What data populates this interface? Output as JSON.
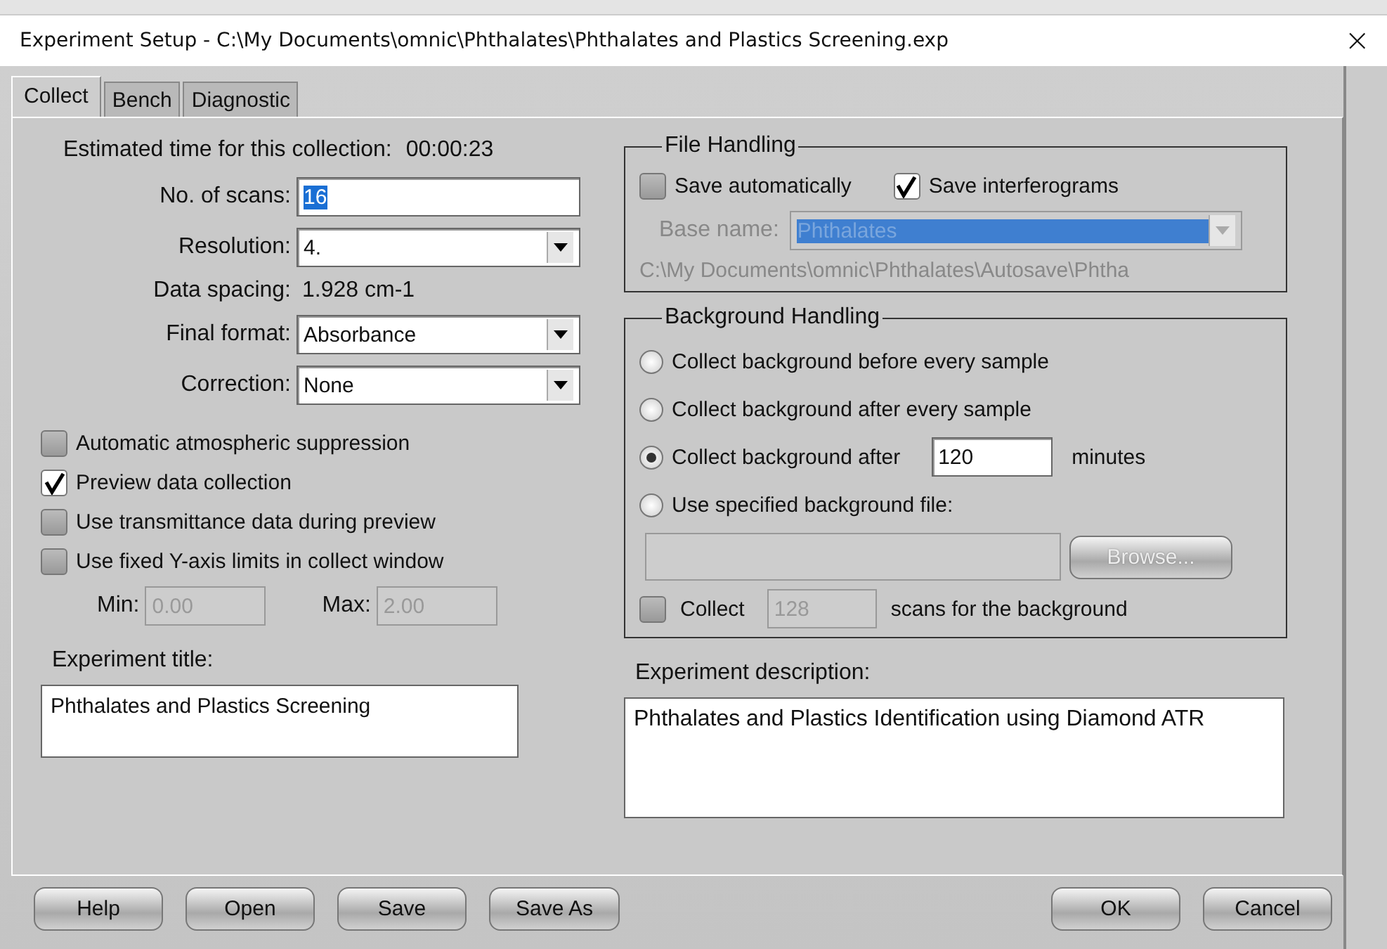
{
  "window": {
    "title": "Experiment Setup - C:\\My Documents\\omnic\\Phthalates\\Phthalates and Plastics Screening.exp",
    "close": "×"
  },
  "tabs": [
    {
      "label": "Collect",
      "selected": true
    },
    {
      "label": "Bench",
      "selected": false
    },
    {
      "label": "Diagnostic",
      "selected": false
    }
  ],
  "collect": {
    "estimated_time": {
      "label": "Estimated time for this collection:",
      "value": "00:00:23"
    },
    "settings": [
      {
        "kind": "input",
        "label": "No. of scans:",
        "value": "16",
        "highlighted": true
      },
      {
        "kind": "dropdown",
        "label": "Resolution:",
        "value": "4."
      },
      {
        "kind": "readout",
        "label": "Data spacing:",
        "value": "1.928 cm-1"
      },
      {
        "kind": "dropdown",
        "label": "Final format:",
        "value": "Absorbance"
      },
      {
        "kind": "dropdown",
        "label": "Correction:",
        "value": "None"
      }
    ],
    "options": [
      {
        "label": "Automatic atmospheric suppression",
        "checked": false
      },
      {
        "label": "Preview data collection",
        "checked": true
      },
      {
        "label": "Use transmittance data during preview",
        "checked": false
      },
      {
        "label": "Use fixed Y-axis limits in collect window",
        "checked": false
      }
    ],
    "limits": [
      {
        "label": "Min:",
        "value": "0.00",
        "disabled": true
      },
      {
        "label": "Max:",
        "value": "2.00",
        "disabled": true
      }
    ],
    "experiment_title": {
      "label": "Experiment title:",
      "value": "Phthalates and Plastics Screening"
    },
    "file_handling": {
      "title": "File Handling",
      "checkboxes": [
        {
          "label": "Save automatically",
          "checked": false
        },
        {
          "label": "Save interferograms",
          "checked": true
        }
      ],
      "base_name": {
        "label": "Base name:",
        "value": "Phthalates",
        "disabled": true,
        "highlighted": true
      },
      "path": "C:\\My Documents\\omnic\\Phthalates\\Autosave\\Phtha"
    },
    "background_handling": {
      "title": "Background Handling",
      "options": [
        {
          "kind": "plain",
          "label": "Collect background before every sample",
          "selected": false
        },
        {
          "kind": "plain",
          "label": "Collect background after every sample",
          "selected": false
        },
        {
          "kind": "minutes",
          "label": "Collect background after",
          "value": "120",
          "unit": "minutes",
          "selected": true
        },
        {
          "kind": "file",
          "label": "Use specified background file:",
          "selected": false,
          "browse": "Browse...",
          "disabled": true
        }
      ],
      "scans": {
        "label": "Collect",
        "checked": false,
        "value": "128",
        "disabled": true,
        "suffix": "scans for the background"
      }
    },
    "experiment_description": {
      "label": "Experiment description:",
      "value": "Phthalates and Plastics Identification using Diamond ATR"
    }
  },
  "buttons_left": [
    "Help",
    "Open",
    "Save",
    "Save As"
  ],
  "buttons_right": [
    "OK",
    "Cancel"
  ]
}
